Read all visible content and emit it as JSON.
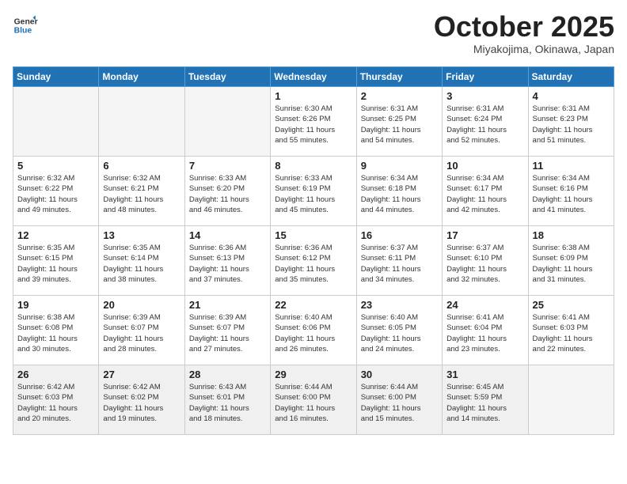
{
  "header": {
    "logo_line1": "General",
    "logo_line2": "Blue",
    "month": "October 2025",
    "location": "Miyakojima, Okinawa, Japan"
  },
  "weekdays": [
    "Sunday",
    "Monday",
    "Tuesday",
    "Wednesday",
    "Thursday",
    "Friday",
    "Saturday"
  ],
  "weeks": [
    [
      {
        "day": "",
        "text": ""
      },
      {
        "day": "",
        "text": ""
      },
      {
        "day": "",
        "text": ""
      },
      {
        "day": "1",
        "text": "Sunrise: 6:30 AM\nSunset: 6:26 PM\nDaylight: 11 hours\nand 55 minutes."
      },
      {
        "day": "2",
        "text": "Sunrise: 6:31 AM\nSunset: 6:25 PM\nDaylight: 11 hours\nand 54 minutes."
      },
      {
        "day": "3",
        "text": "Sunrise: 6:31 AM\nSunset: 6:24 PM\nDaylight: 11 hours\nand 52 minutes."
      },
      {
        "day": "4",
        "text": "Sunrise: 6:31 AM\nSunset: 6:23 PM\nDaylight: 11 hours\nand 51 minutes."
      }
    ],
    [
      {
        "day": "5",
        "text": "Sunrise: 6:32 AM\nSunset: 6:22 PM\nDaylight: 11 hours\nand 49 minutes."
      },
      {
        "day": "6",
        "text": "Sunrise: 6:32 AM\nSunset: 6:21 PM\nDaylight: 11 hours\nand 48 minutes."
      },
      {
        "day": "7",
        "text": "Sunrise: 6:33 AM\nSunset: 6:20 PM\nDaylight: 11 hours\nand 46 minutes."
      },
      {
        "day": "8",
        "text": "Sunrise: 6:33 AM\nSunset: 6:19 PM\nDaylight: 11 hours\nand 45 minutes."
      },
      {
        "day": "9",
        "text": "Sunrise: 6:34 AM\nSunset: 6:18 PM\nDaylight: 11 hours\nand 44 minutes."
      },
      {
        "day": "10",
        "text": "Sunrise: 6:34 AM\nSunset: 6:17 PM\nDaylight: 11 hours\nand 42 minutes."
      },
      {
        "day": "11",
        "text": "Sunrise: 6:34 AM\nSunset: 6:16 PM\nDaylight: 11 hours\nand 41 minutes."
      }
    ],
    [
      {
        "day": "12",
        "text": "Sunrise: 6:35 AM\nSunset: 6:15 PM\nDaylight: 11 hours\nand 39 minutes."
      },
      {
        "day": "13",
        "text": "Sunrise: 6:35 AM\nSunset: 6:14 PM\nDaylight: 11 hours\nand 38 minutes."
      },
      {
        "day": "14",
        "text": "Sunrise: 6:36 AM\nSunset: 6:13 PM\nDaylight: 11 hours\nand 37 minutes."
      },
      {
        "day": "15",
        "text": "Sunrise: 6:36 AM\nSunset: 6:12 PM\nDaylight: 11 hours\nand 35 minutes."
      },
      {
        "day": "16",
        "text": "Sunrise: 6:37 AM\nSunset: 6:11 PM\nDaylight: 11 hours\nand 34 minutes."
      },
      {
        "day": "17",
        "text": "Sunrise: 6:37 AM\nSunset: 6:10 PM\nDaylight: 11 hours\nand 32 minutes."
      },
      {
        "day": "18",
        "text": "Sunrise: 6:38 AM\nSunset: 6:09 PM\nDaylight: 11 hours\nand 31 minutes."
      }
    ],
    [
      {
        "day": "19",
        "text": "Sunrise: 6:38 AM\nSunset: 6:08 PM\nDaylight: 11 hours\nand 30 minutes."
      },
      {
        "day": "20",
        "text": "Sunrise: 6:39 AM\nSunset: 6:07 PM\nDaylight: 11 hours\nand 28 minutes."
      },
      {
        "day": "21",
        "text": "Sunrise: 6:39 AM\nSunset: 6:07 PM\nDaylight: 11 hours\nand 27 minutes."
      },
      {
        "day": "22",
        "text": "Sunrise: 6:40 AM\nSunset: 6:06 PM\nDaylight: 11 hours\nand 26 minutes."
      },
      {
        "day": "23",
        "text": "Sunrise: 6:40 AM\nSunset: 6:05 PM\nDaylight: 11 hours\nand 24 minutes."
      },
      {
        "day": "24",
        "text": "Sunrise: 6:41 AM\nSunset: 6:04 PM\nDaylight: 11 hours\nand 23 minutes."
      },
      {
        "day": "25",
        "text": "Sunrise: 6:41 AM\nSunset: 6:03 PM\nDaylight: 11 hours\nand 22 minutes."
      }
    ],
    [
      {
        "day": "26",
        "text": "Sunrise: 6:42 AM\nSunset: 6:03 PM\nDaylight: 11 hours\nand 20 minutes."
      },
      {
        "day": "27",
        "text": "Sunrise: 6:42 AM\nSunset: 6:02 PM\nDaylight: 11 hours\nand 19 minutes."
      },
      {
        "day": "28",
        "text": "Sunrise: 6:43 AM\nSunset: 6:01 PM\nDaylight: 11 hours\nand 18 minutes."
      },
      {
        "day": "29",
        "text": "Sunrise: 6:44 AM\nSunset: 6:00 PM\nDaylight: 11 hours\nand 16 minutes."
      },
      {
        "day": "30",
        "text": "Sunrise: 6:44 AM\nSunset: 6:00 PM\nDaylight: 11 hours\nand 15 minutes."
      },
      {
        "day": "31",
        "text": "Sunrise: 6:45 AM\nSunset: 5:59 PM\nDaylight: 11 hours\nand 14 minutes."
      },
      {
        "day": "",
        "text": ""
      }
    ]
  ]
}
